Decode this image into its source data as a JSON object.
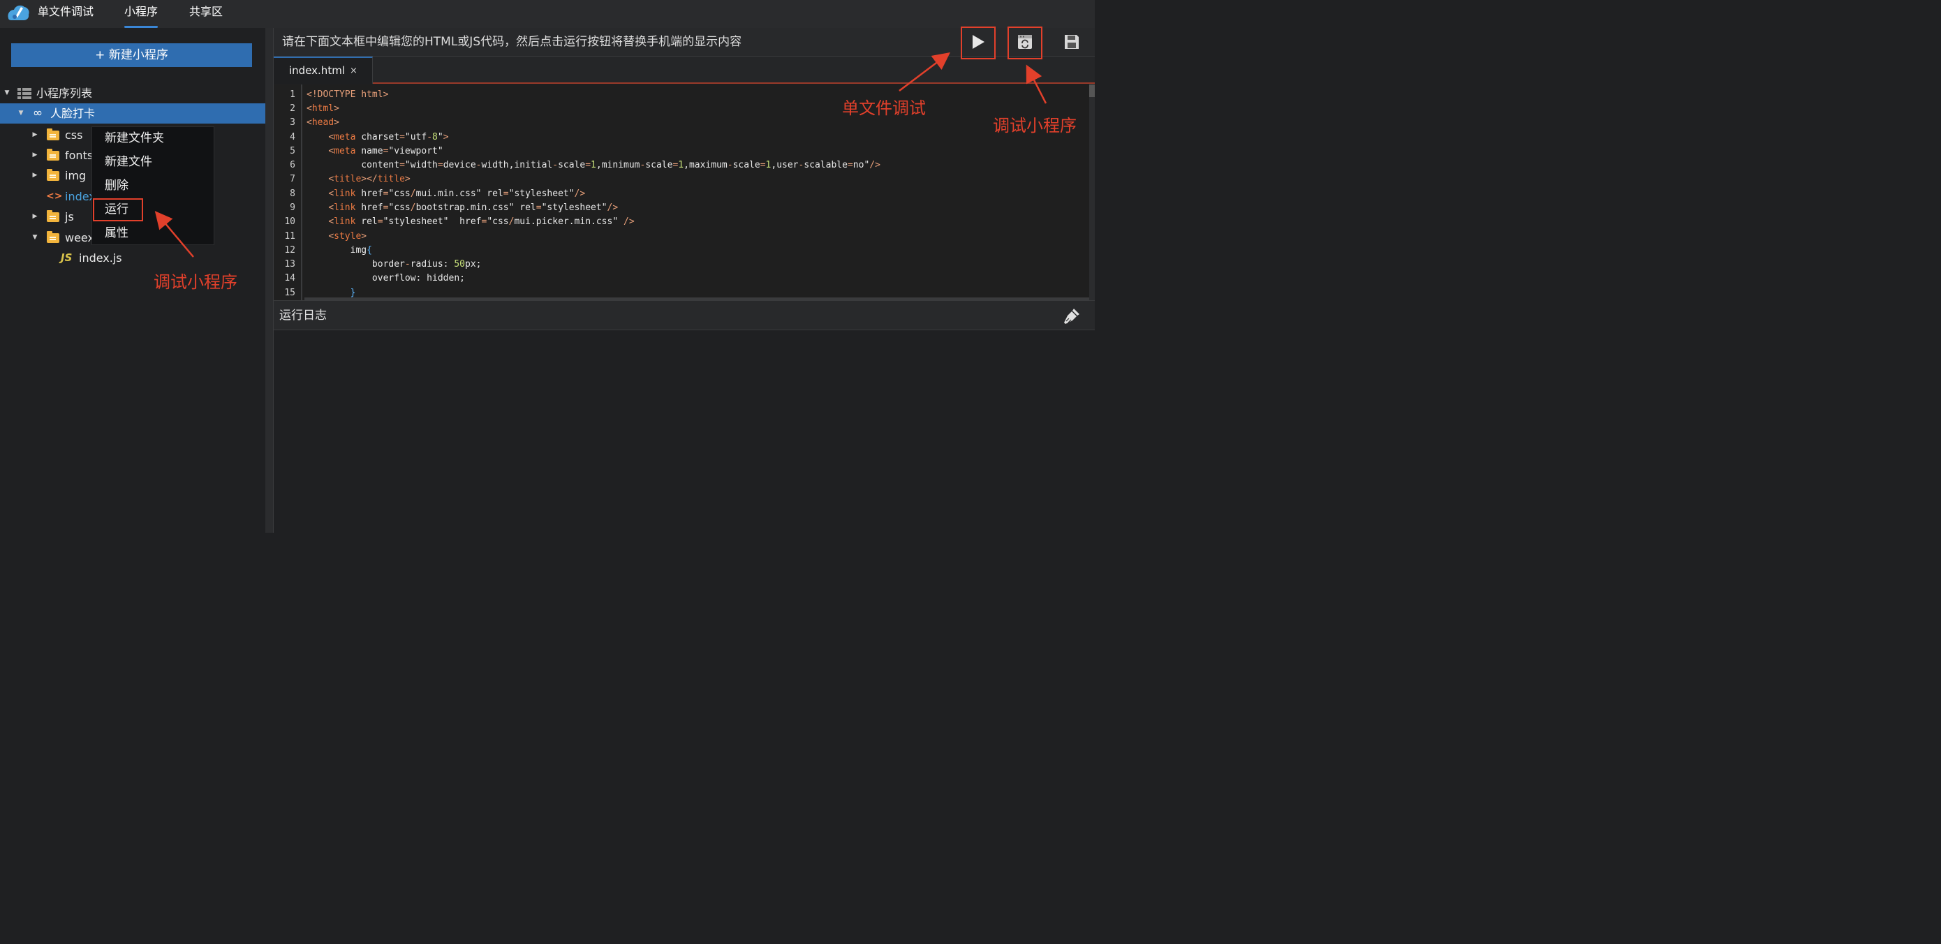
{
  "nav": {
    "tabs": [
      {
        "label": "单文件调试"
      },
      {
        "label": "小程序"
      },
      {
        "label": "共享区"
      }
    ]
  },
  "sidebar": {
    "new_button": "+ 新建小程序",
    "tree": {
      "root_label": "小程序列表",
      "project_label": "人脸打卡",
      "items": [
        {
          "label": "css",
          "type": "folder"
        },
        {
          "label": "fonts",
          "type": "folder"
        },
        {
          "label": "img",
          "type": "folder"
        },
        {
          "label": "index.html",
          "type": "html-file"
        },
        {
          "label": "js",
          "type": "folder"
        },
        {
          "label": "weex",
          "type": "folder"
        },
        {
          "label": "index.js",
          "type": "js-file"
        }
      ]
    },
    "context_menu": [
      {
        "label": "新建文件夹"
      },
      {
        "label": "新建文件"
      },
      {
        "label": "删除"
      },
      {
        "label": "运行"
      },
      {
        "label": "属性"
      }
    ]
  },
  "toolbar": {
    "instruction": "请在下面文本框中编辑您的HTML或JS代码，然后点击运行按钮将替换手机端的显示内容",
    "run_icon": "play-icon",
    "debug_icon": "debug-miniprogram-icon",
    "save_icon": "save-icon"
  },
  "editor": {
    "tab_label": "index.html",
    "tab_close": "×",
    "line_numbers": [
      "1",
      "2",
      "3",
      "4",
      "5",
      "6",
      "7",
      "8",
      "9",
      "10",
      "11",
      "12",
      "13",
      "14",
      "15"
    ]
  },
  "log": {
    "title": "运行日志",
    "clear_icon": "broom-icon"
  },
  "annotations": {
    "single_file_debug": "单文件调试",
    "debug_miniprogram_top": "调试小程序",
    "debug_miniprogram_menu": "调试小程序",
    "color": "#e2402b"
  },
  "colors": {
    "accent": "#2f6db0",
    "annotation": "#e2402b",
    "folder": "#f2b43c"
  }
}
